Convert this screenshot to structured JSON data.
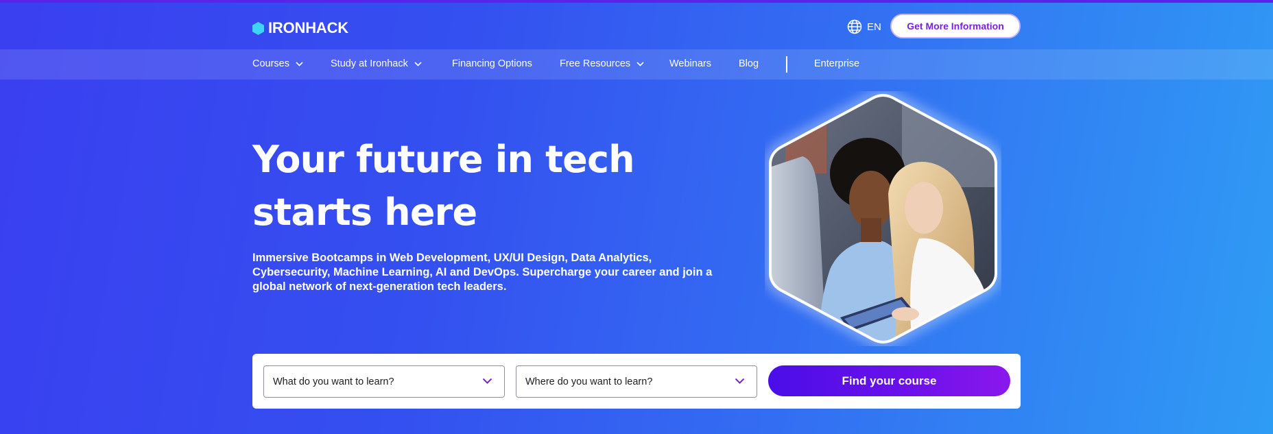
{
  "header": {
    "logo_text": "IRONHACK",
    "language": "EN",
    "cta_label": "Get More Information"
  },
  "nav": {
    "items": [
      {
        "label": "Courses",
        "has_dropdown": true
      },
      {
        "label": "Study at Ironhack",
        "has_dropdown": true
      },
      {
        "label": "Financing Options",
        "has_dropdown": false
      },
      {
        "label": "Free Resources",
        "has_dropdown": true
      },
      {
        "label": "Webinars",
        "has_dropdown": false
      },
      {
        "label": "Blog",
        "has_dropdown": false
      },
      {
        "label": "Enterprise",
        "has_dropdown": false
      }
    ]
  },
  "hero": {
    "title": "Your future in tech starts here",
    "subtitle": "Immersive Bootcamps in Web Development, UX/UI Design, Data Analytics, Cybersecurity, Machine Learning, AI and DevOps. Supercharge your career and join a global network of next-generation tech leaders."
  },
  "search": {
    "what_placeholder": "What do you want to learn?",
    "where_placeholder": "Where do you want to learn?",
    "button_label": "Find your course"
  },
  "icons": {
    "logo": "hexagon-logo-icon",
    "language": "globe-icon",
    "dropdown": "chevron-down-icon"
  },
  "colors": {
    "accent_purple": "#7a1fe0",
    "logo_cyan": "#3fd4f5",
    "button_gradient_start": "#4a0ee8",
    "button_gradient_end": "#8a18ec"
  }
}
